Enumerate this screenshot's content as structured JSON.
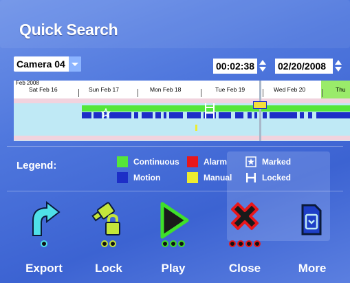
{
  "title": "Quick Search",
  "camera": {
    "selected": "Camera 04"
  },
  "time_value": "00:02:38",
  "date_value": "02/20/2008",
  "timeline": {
    "month_label": "Feb 2008",
    "days": [
      "Sat Feb 16",
      "Sun Feb 17",
      "Mon Feb 18",
      "Tue Feb 19",
      "Wed Feb 20",
      "Thu"
    ]
  },
  "legend": {
    "title": "Legend:",
    "items": [
      {
        "label": "Continuous",
        "color": "#55e63a"
      },
      {
        "label": "Alarm",
        "color": "#e8171b"
      },
      {
        "label": "Marked",
        "icon": "star-icon"
      },
      {
        "label": "Motion",
        "color": "#1d2ec7"
      },
      {
        "label": "Manual",
        "color": "#ecec30"
      },
      {
        "label": "Locked",
        "icon": "lock-bar-icon"
      }
    ]
  },
  "actions": [
    {
      "label": "Export",
      "icon": "export-arrow-icon"
    },
    {
      "label": "Lock",
      "icon": "lock-camera-icon"
    },
    {
      "label": "Play",
      "icon": "play-icon"
    },
    {
      "label": "Close",
      "icon": "close-x-icon"
    },
    {
      "label": "More",
      "icon": "more-folder-icon"
    }
  ],
  "colors": {
    "background": "#4f77dd",
    "accent_cyan": "#4fe0e8"
  }
}
